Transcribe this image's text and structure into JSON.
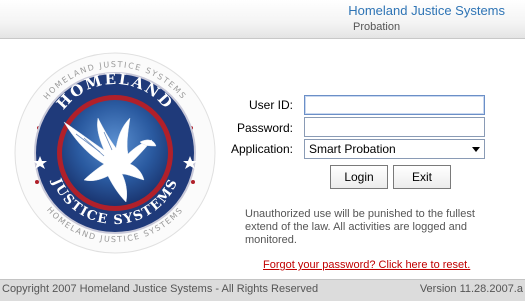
{
  "header": {
    "title": "Homeland Justice Systems",
    "subtitle": "Probation"
  },
  "logo": {
    "top_text": "HOMELAND",
    "bottom_text": "JUSTICE SYSTEMS",
    "ring_text_top": "HOMELAND JUSTICE SYSTEMS",
    "ring_text_bottom": "HOMELAND JUSTICE SYSTEMS"
  },
  "form": {
    "user_id_label": "User ID:",
    "user_id_value": "",
    "password_label": "Password:",
    "password_value": "",
    "application_label": "Application:",
    "application_selected": "Smart Probation",
    "login_label": "Login",
    "exit_label": "Exit"
  },
  "notice": "Unauthorized use will be punished to the fullest extend of the law.  All activities are logged and monitored.",
  "forgot_link": "Forgot your password? Click here to reset.",
  "footer": {
    "copyright": "Copyright 2007 Homeland Justice Systems - All Rights Reserved",
    "version": "Version 11.28.2007.a"
  },
  "colors": {
    "title_blue": "#2e74b5",
    "link_red": "#c00000",
    "logo_navy": "#1f3a7a",
    "logo_red": "#b0202a"
  }
}
